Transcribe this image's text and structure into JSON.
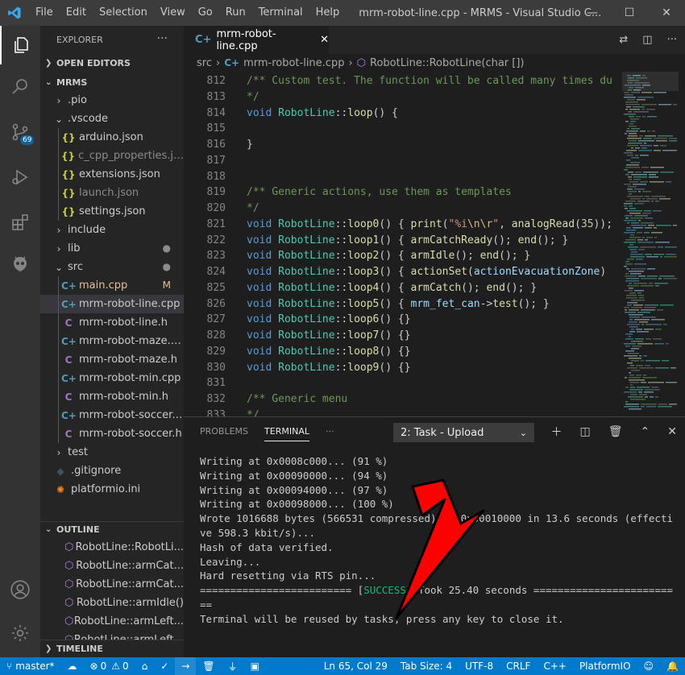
{
  "titlebar": {
    "menu": [
      "File",
      "Edit",
      "Selection",
      "View",
      "Go",
      "Run",
      "Terminal",
      "Help"
    ],
    "title": "mrm-robot-line.cpp - MRMS - Visual Studio C..."
  },
  "activity": {
    "scm_badge": "69"
  },
  "sidebar": {
    "title": "EXPLORER",
    "more": "···",
    "open_editors": "OPEN EDITORS",
    "project": "MRMS",
    "tree": [
      {
        "label": ".pio",
        "type": "folder",
        "open": false,
        "depth": 1,
        "dim": false
      },
      {
        "label": ".vscode",
        "type": "folder",
        "open": true,
        "depth": 1,
        "dim": false
      },
      {
        "label": "arduino.json",
        "type": "json",
        "depth": 2,
        "dim": false
      },
      {
        "label": "c_cpp_properties.json",
        "type": "json",
        "depth": 2,
        "dim": true
      },
      {
        "label": "extensions.json",
        "type": "json",
        "depth": 2,
        "dim": false
      },
      {
        "label": "launch.json",
        "type": "json",
        "depth": 2,
        "dim": true
      },
      {
        "label": "settings.json",
        "type": "json",
        "depth": 2,
        "dim": false
      },
      {
        "label": "include",
        "type": "folder",
        "open": false,
        "depth": 1,
        "dim": false
      },
      {
        "label": "lib",
        "type": "folder",
        "open": false,
        "depth": 1,
        "dim": false,
        "deco": "●"
      },
      {
        "label": "src",
        "type": "folder",
        "open": true,
        "depth": 1,
        "dim": false,
        "deco": "●"
      },
      {
        "label": "main.cpp",
        "type": "cpp",
        "depth": 2,
        "dim": false,
        "deco": "M",
        "modified": true
      },
      {
        "label": "mrm-robot-line.cpp",
        "type": "cpp",
        "depth": 2,
        "dim": false,
        "selected": true
      },
      {
        "label": "mrm-robot-line.h",
        "type": "h",
        "depth": 2,
        "dim": false
      },
      {
        "label": "mrm-robot-maze.cpp",
        "type": "cpp",
        "depth": 2,
        "dim": false
      },
      {
        "label": "mrm-robot-maze.h",
        "type": "h",
        "depth": 2,
        "dim": false
      },
      {
        "label": "mrm-robot-min.cpp",
        "type": "cpp",
        "depth": 2,
        "dim": false
      },
      {
        "label": "mrm-robot-min.h",
        "type": "h",
        "depth": 2,
        "dim": false
      },
      {
        "label": "mrm-robot-soccer.c...",
        "type": "cpp",
        "depth": 2,
        "dim": false
      },
      {
        "label": "mrm-robot-soccer.h",
        "type": "h",
        "depth": 2,
        "dim": false
      },
      {
        "label": "test",
        "type": "folder",
        "open": false,
        "depth": 1,
        "dim": false
      },
      {
        "label": ".gitignore",
        "type": "git",
        "depth": 1,
        "dim": false
      },
      {
        "label": "platformio.ini",
        "type": "pio",
        "depth": 1,
        "dim": false
      }
    ],
    "outline": "OUTLINE",
    "outline_items": [
      "RobotLine::RobotLi...",
      "RobotLine::armCat...",
      "RobotLine::armCat...",
      "RobotLine::armIdle()",
      "RobotLine::armLeft...",
      "RobotLine::armLeft..."
    ],
    "timeline": "TIMELINE"
  },
  "tab": {
    "label": "mrm-robot-line.cpp",
    "close": "✕"
  },
  "breadcrumb": {
    "src": "src",
    "file": "mrm-robot-line.cpp",
    "symbol": "RobotLine::RobotLine(char [])"
  },
  "code": [
    {
      "n": "812",
      "html": "<span class='cm'>/** Custom test. The function will be called many times du</span>"
    },
    {
      "n": "813",
      "html": "<span class='cm'>*/</span>"
    },
    {
      "n": "814",
      "html": "<span class='kw'>void</span> <span class='cls'>RobotLine</span>::<span class='fn'>loop</span>() {"
    },
    {
      "n": "815",
      "html": ""
    },
    {
      "n": "816",
      "html": "}"
    },
    {
      "n": "817",
      "html": ""
    },
    {
      "n": "818",
      "html": ""
    },
    {
      "n": "819",
      "html": "<span class='cm'>/** Generic actions, use them as templates</span>"
    },
    {
      "n": "820",
      "html": "<span class='cm'>*/</span>"
    },
    {
      "n": "821",
      "html": "<span class='kw'>void</span> <span class='cls'>RobotLine</span>::<span class='fn'>loop0</span>() { <span class='fn'>print</span>(<span class='str'>\"%i</span><span class='esc'>\\n\\r</span><span class='str'>\"</span>, <span class='fn'>analogRead</span>(<span class='num'>35</span>));"
    },
    {
      "n": "822",
      "html": "<span class='kw'>void</span> <span class='cls'>RobotLine</span>::<span class='fn'>loop1</span>() { <span class='fn'>armCatchReady</span>(); <span class='fn'>end</span>(); }"
    },
    {
      "n": "823",
      "html": "<span class='kw'>void</span> <span class='cls'>RobotLine</span>::<span class='fn'>loop2</span>() { <span class='fn'>armIdle</span>(); <span class='fn'>end</span>(); }"
    },
    {
      "n": "824",
      "html": "<span class='kw'>void</span> <span class='cls'>RobotLine</span>::<span class='fn'>loop3</span>() { <span class='fn'>actionSet</span>(<span class='var'>actionEvacuationZone</span>)"
    },
    {
      "n": "825",
      "html": "<span class='kw'>void</span> <span class='cls'>RobotLine</span>::<span class='fn'>loop4</span>() { <span class='fn'>armCatch</span>(); <span class='fn'>end</span>(); }"
    },
    {
      "n": "826",
      "html": "<span class='kw'>void</span> <span class='cls'>RobotLine</span>::<span class='fn'>loop5</span>() { <span class='var'>mrm_fet_can</span>-&gt;<span class='fn'>test</span>(); }"
    },
    {
      "n": "827",
      "html": "<span class='kw'>void</span> <span class='cls'>RobotLine</span>::<span class='fn'>loop6</span>() {}"
    },
    {
      "n": "828",
      "html": "<span class='kw'>void</span> <span class='cls'>RobotLine</span>::<span class='fn'>loop7</span>() {}"
    },
    {
      "n": "829",
      "html": "<span class='kw'>void</span> <span class='cls'>RobotLine</span>::<span class='fn'>loop8</span>() {}"
    },
    {
      "n": "830",
      "html": "<span class='kw'>void</span> <span class='cls'>RobotLine</span>::<span class='fn'>loop9</span>() {}"
    },
    {
      "n": "831",
      "html": ""
    },
    {
      "n": "832",
      "html": "<span class='cm'>/** Generic menu</span>"
    },
    {
      "n": "833",
      "html": "<span class='cm'>*/</span>"
    }
  ],
  "panel": {
    "tabs": [
      "PROBLEMS",
      "TERMINAL"
    ],
    "more": "···",
    "task_select": "2: Task - Upload",
    "terminal_lines": [
      "Writing at 0x0008c000... (91 %)",
      "Writing at 0x00090000... (94 %)",
      "Writing at 0x00094000... (97 %)",
      "Writing at 0x00098000... (100 %)",
      "Wrote 1016688 bytes (566531 compressed) at 0x00010000 in 13.6 seconds (effective 598.3 kbit/s)...",
      "Hash of data verified.",
      "",
      "Leaving...",
      "Hard resetting via RTS pin...",
      "========================= [SUCCESS] Took 25.40 seconds =========================",
      "",
      "Terminal will be reused by tasks, press any key to close it."
    ]
  },
  "status": {
    "branch": "master*",
    "errors": "0",
    "warnings": "0",
    "position": "Ln 65, Col 29",
    "tab_size": "Tab Size: 4",
    "encoding": "UTF-8",
    "eol": "CRLF",
    "language": "C++",
    "platform": "PlatformIO"
  },
  "colors": {
    "accent": "#007acc",
    "success": "#0dbc79",
    "arrow": "#ff0000"
  }
}
